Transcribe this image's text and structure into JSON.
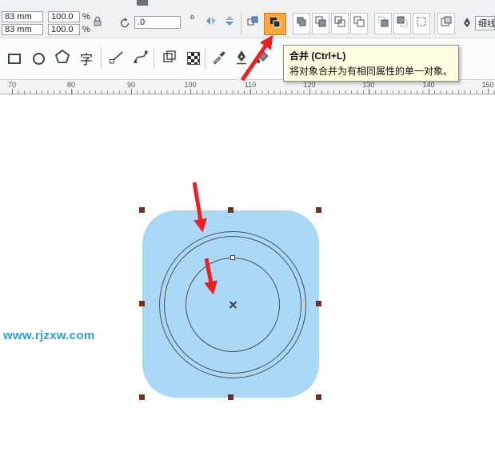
{
  "property_bar": {
    "object_width": "83 mm",
    "object_height": "83 mm",
    "scale_h": "100.0",
    "scale_v": "100.0",
    "percent": "%",
    "rotation_angle": ".0",
    "degree_symbol": "o",
    "outline_width_value": "细线"
  },
  "toolbox": {
    "text_tool_label": "字"
  },
  "ruler": {
    "ticks": [
      "70",
      "80",
      "90",
      "100",
      "110",
      "120",
      "130",
      "140",
      "150"
    ]
  },
  "tooltip": {
    "title": "合并 (Ctrl+L)",
    "description": "将对象合并为有相同属性的单一对象。"
  },
  "canvas": {
    "watermark": "www.rjzxw.com"
  },
  "icons": {
    "lock": "padlock",
    "rotate": "circular-arrow",
    "mirror_h": "horizontal-mirror-triangles",
    "mirror_v": "vertical-mirror-triangles",
    "group": "two-squares-blue",
    "combine": "two-overlapping-filled-squares",
    "shaping": [
      "weld",
      "trim",
      "intersect",
      "simplify",
      "front-minus-back",
      "back-minus-front",
      "create-boundary"
    ],
    "outline_pen": "pen-nib",
    "tools": [
      "rectangle",
      "ellipse",
      "polygon",
      "text",
      "freehand",
      "bezier",
      "contour",
      "pattern-checkerboard",
      "eyedropper",
      "outline-pen",
      "fill"
    ]
  },
  "colors": {
    "selection_fill": "#a9d9f7",
    "handle": "#76301b",
    "arrow": "#ec2024",
    "button_highlight": "#f8a93e",
    "tooltip_bg": "#fffee3",
    "watermark_blue": "#2a9fe0"
  }
}
